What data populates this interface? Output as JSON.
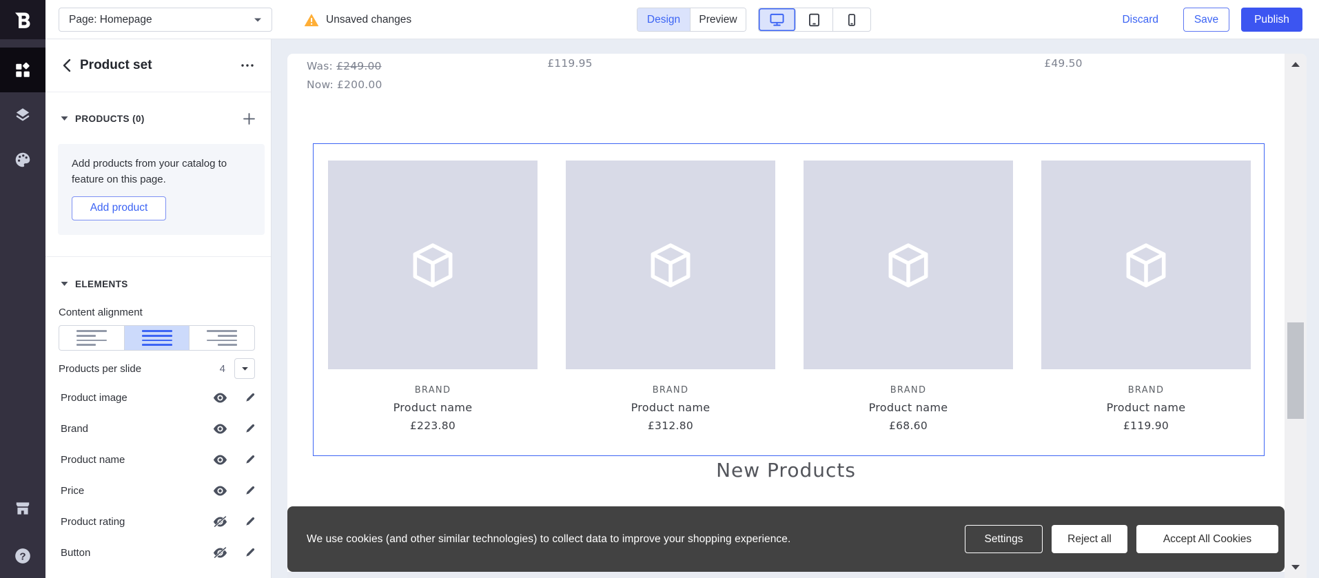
{
  "topbar": {
    "page_selector_value": "Page: Homepage",
    "unsaved_label": "Unsaved changes",
    "design_label": "Design",
    "preview_label": "Preview",
    "discard_label": "Discard",
    "save_label": "Save",
    "publish_label": "Publish"
  },
  "rail": {
    "icons": [
      "widgets",
      "layers",
      "theme-palette",
      "storefront",
      "help"
    ]
  },
  "sidebar": {
    "title": "Product set",
    "products": {
      "heading": "PRODUCTS (0)",
      "info_text": "Add products from your catalog to feature on this page.",
      "add_button_label": "Add product"
    },
    "elements": {
      "heading": "ELEMENTS",
      "content_alignment_label": "Content alignment",
      "products_per_slide_label": "Products per slide",
      "products_per_slide_value": "4",
      "rows": [
        {
          "label": "Product image",
          "visible": true
        },
        {
          "label": "Brand",
          "visible": true
        },
        {
          "label": "Product name",
          "visible": true
        },
        {
          "label": "Price",
          "visible": true
        },
        {
          "label": "Product rating",
          "visible": false
        },
        {
          "label": "Button",
          "visible": false
        }
      ]
    }
  },
  "canvas": {
    "above": {
      "was_label": "Was:",
      "was_price": "£249.00",
      "now_line": "Now: £200.00",
      "price_col2": "£119.95",
      "price_col4": "£49.50"
    },
    "product_set": {
      "cards": [
        {
          "brand": "BRAND",
          "name": "Product name",
          "price": "£223.80"
        },
        {
          "brand": "BRAND",
          "name": "Product name",
          "price": "£312.80"
        },
        {
          "brand": "BRAND",
          "name": "Product name",
          "price": "£68.60"
        },
        {
          "brand": "BRAND",
          "name": "Product name",
          "price": "£119.90"
        }
      ]
    },
    "section_heading": "New Products",
    "cookie": {
      "message": "We use cookies (and other similar technologies) to collect data to improve your shopping experience.",
      "settings_label": "Settings",
      "reject_label": "Reject all",
      "accept_label": "Accept All Cookies"
    }
  },
  "colors": {
    "accent": "#3C64F4",
    "selected_segment_bg": "#DBE3FC",
    "warning": "#FFAE36",
    "rail_bg": "#343140",
    "rail_selected_bg": "#0D0B12",
    "workspace_bg": "#E9EDF4",
    "image_placeholder": "#D8DAE7",
    "cookie_bar_bg": "#424242"
  }
}
